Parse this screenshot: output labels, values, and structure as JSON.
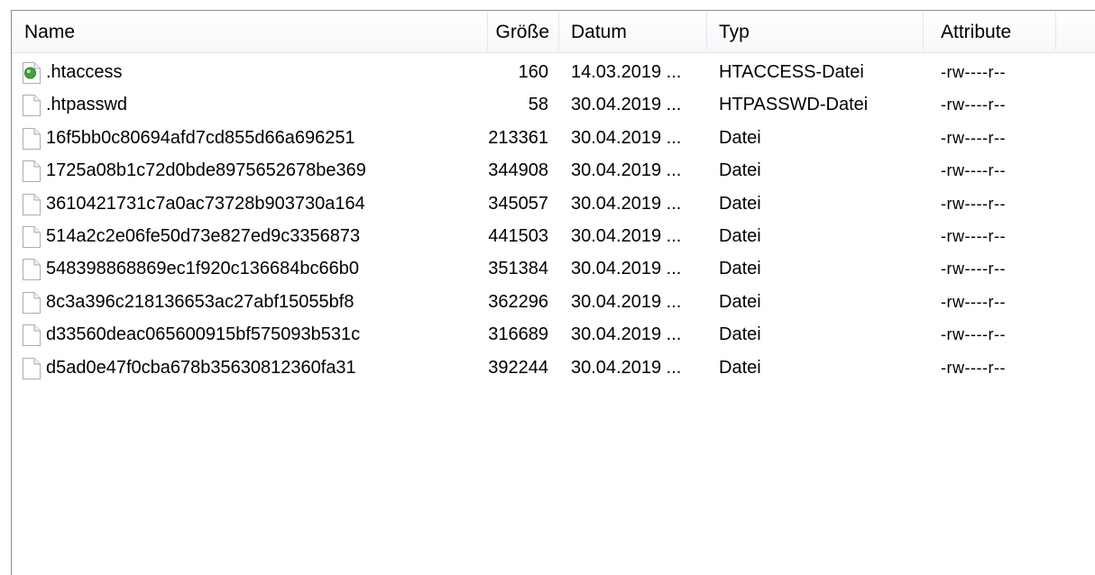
{
  "columns": {
    "name": "Name",
    "size": "Größe",
    "date": "Datum",
    "type": "Typ",
    "attributes": "Attribute"
  },
  "files": [
    {
      "name": ".htaccess",
      "size": "160",
      "date": "14.03.2019 ...",
      "type": "HTACCESS-Datei",
      "attributes": "-rw----r--",
      "icon": "htaccess-file-icon"
    },
    {
      "name": ".htpasswd",
      "size": "58",
      "date": "30.04.2019 ...",
      "type": "HTPASSWD-Datei",
      "attributes": "-rw----r--",
      "icon": "file-icon"
    },
    {
      "name": "16f5bb0c80694afd7cd855d66a696251",
      "size": "213361",
      "date": "30.04.2019 ...",
      "type": "Datei",
      "attributes": "-rw----r--",
      "icon": "file-icon"
    },
    {
      "name": "1725a08b1c72d0bde8975652678be369",
      "size": "344908",
      "date": "30.04.2019 ...",
      "type": "Datei",
      "attributes": "-rw----r--",
      "icon": "file-icon"
    },
    {
      "name": "3610421731c7a0ac73728b903730a164",
      "size": "345057",
      "date": "30.04.2019 ...",
      "type": "Datei",
      "attributes": "-rw----r--",
      "icon": "file-icon"
    },
    {
      "name": "514a2c2e06fe50d73e827ed9c3356873",
      "size": "441503",
      "date": "30.04.2019 ...",
      "type": "Datei",
      "attributes": "-rw----r--",
      "icon": "file-icon"
    },
    {
      "name": "548398868869ec1f920c136684bc66b0",
      "size": "351384",
      "date": "30.04.2019 ...",
      "type": "Datei",
      "attributes": "-rw----r--",
      "icon": "file-icon"
    },
    {
      "name": "8c3a396c218136653ac27abf15055bf8",
      "size": "362296",
      "date": "30.04.2019 ...",
      "type": "Datei",
      "attributes": "-rw----r--",
      "icon": "file-icon"
    },
    {
      "name": "d33560deac065600915bf575093b531c",
      "size": "316689",
      "date": "30.04.2019 ...",
      "type": "Datei",
      "attributes": "-rw----r--",
      "icon": "file-icon"
    },
    {
      "name": "d5ad0e47f0cba678b35630812360fa31",
      "size": "392244",
      "date": "30.04.2019 ...",
      "type": "Datei",
      "attributes": "-rw----r--",
      "icon": "file-icon"
    }
  ]
}
